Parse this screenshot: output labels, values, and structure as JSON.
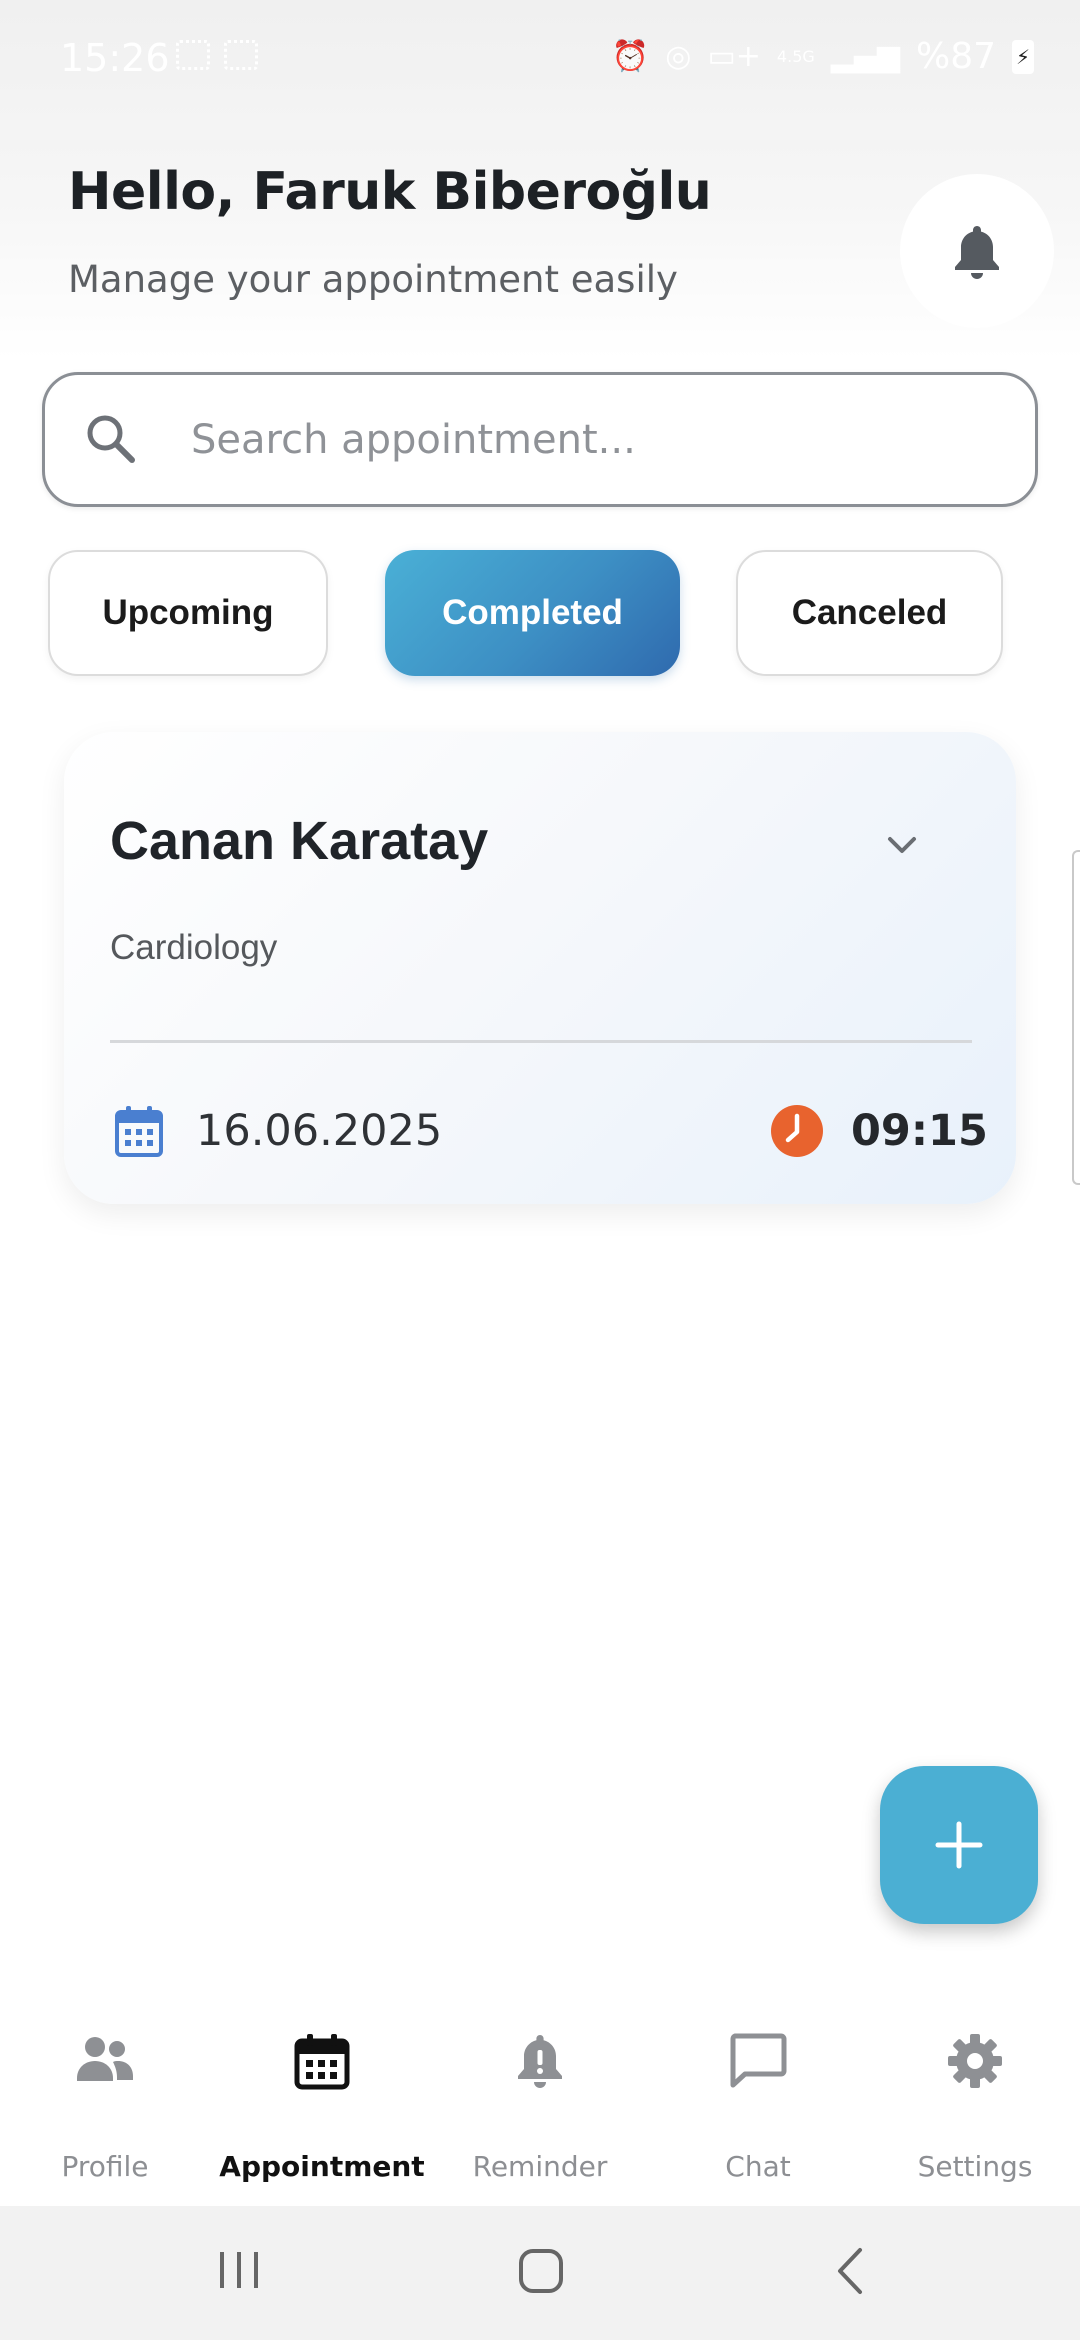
{
  "status_bar": {
    "time": "15:26",
    "network": "4.5G",
    "battery": "%87"
  },
  "header": {
    "greeting": "Hello, Faruk Biberoğlu",
    "subtitle": "Manage your appointment easily"
  },
  "search": {
    "placeholder": "Search appointment..."
  },
  "tabs": [
    {
      "label": "Upcoming",
      "active": false
    },
    {
      "label": "Completed",
      "active": true
    },
    {
      "label": "Canceled",
      "active": false
    }
  ],
  "appointment": {
    "doctor": "Canan Karatay",
    "department": "Cardiology",
    "date": "16.06.2025",
    "time": "09:15"
  },
  "bottom_nav": [
    {
      "label": "Profile",
      "icon": "people-icon",
      "active": false
    },
    {
      "label": "Appointment",
      "icon": "calendar-icon",
      "active": true
    },
    {
      "label": "Reminder",
      "icon": "alert-bell-icon",
      "active": false
    },
    {
      "label": "Chat",
      "icon": "chat-bubble-icon",
      "active": false
    },
    {
      "label": "Settings",
      "icon": "gear-icon",
      "active": false
    }
  ],
  "colors": {
    "accent": "#4bafd3",
    "tab_gradient_start": "#4ab0d6",
    "tab_gradient_end": "#2f6aae",
    "calendar_icon": "#4a7fd0",
    "clock_icon": "#e8632e"
  }
}
